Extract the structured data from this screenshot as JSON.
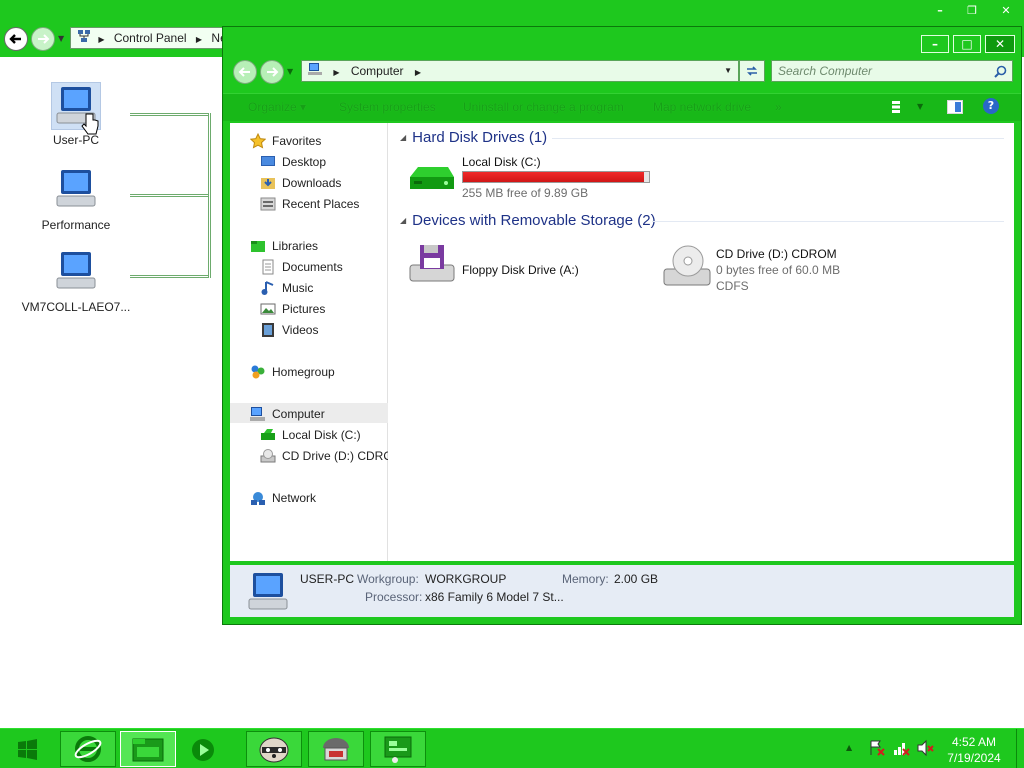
{
  "background_window": {
    "nav": {
      "back_icon": "back-arrow-icon",
      "forward_icon": "forward-arrow-icon",
      "address_breadcrumb": [
        "Control Panel",
        "Ne"
      ]
    },
    "nodes": [
      {
        "label": "User-PC"
      },
      {
        "label": "Performance"
      },
      {
        "label": "VM7COLL-LAEO7..."
      }
    ],
    "title_buttons": {
      "minimize": "–",
      "restore": "❐",
      "close": "✕"
    }
  },
  "explorer": {
    "title_buttons": {
      "minimize": "–",
      "maximize": "□",
      "close": "✕"
    },
    "address": {
      "breadcrumb": "Computer"
    },
    "search": {
      "placeholder": "Search Computer"
    },
    "toolbar": {
      "organize": "Organize ▾",
      "system_properties": "System properties",
      "uninstall": "Uninstall or change a program",
      "map_drive": "Map network drive",
      "more": "»"
    },
    "sidebar": {
      "favorites": "Favorites",
      "desktop": "Desktop",
      "downloads": "Downloads",
      "recent_places": "Recent Places",
      "libraries": "Libraries",
      "documents": "Documents",
      "music": "Music",
      "pictures": "Pictures",
      "videos": "Videos",
      "homegroup": "Homegroup",
      "computer": "Computer",
      "local_disk": "Local Disk (C:)",
      "cd_drive": "CD Drive (D:) CDROM",
      "network": "Network"
    },
    "groups": {
      "hard_disk": "Hard Disk Drives (1)",
      "removable": "Devices with Removable Storage (2)"
    },
    "drives": {
      "c": {
        "name": "Local Disk (C:)",
        "free": "255 MB free of 9.89 GB",
        "used_fraction": 0.975
      },
      "a": {
        "name": "Floppy Disk Drive (A:)"
      },
      "d": {
        "name": "CD Drive (D:) CDROM",
        "free": "0 bytes free of 60.0 MB",
        "fs": "CDFS"
      }
    },
    "details": {
      "name": "USER-PC",
      "workgroup_label": "Workgroup:",
      "workgroup": "WORKGROUP",
      "memory_label": "Memory:",
      "memory": "2.00 GB",
      "processor_label": "Processor:",
      "processor": "x86 Family 6 Model 7 St..."
    }
  },
  "taskbar": {
    "clock_time": "4:52 AM",
    "clock_date": "7/19/2024",
    "tray_arrow": "▲"
  },
  "colors": {
    "chrome_green": "#1ec81e",
    "disk_bar_red": "#e01e1e",
    "group_header_blue": "#1e3287"
  }
}
